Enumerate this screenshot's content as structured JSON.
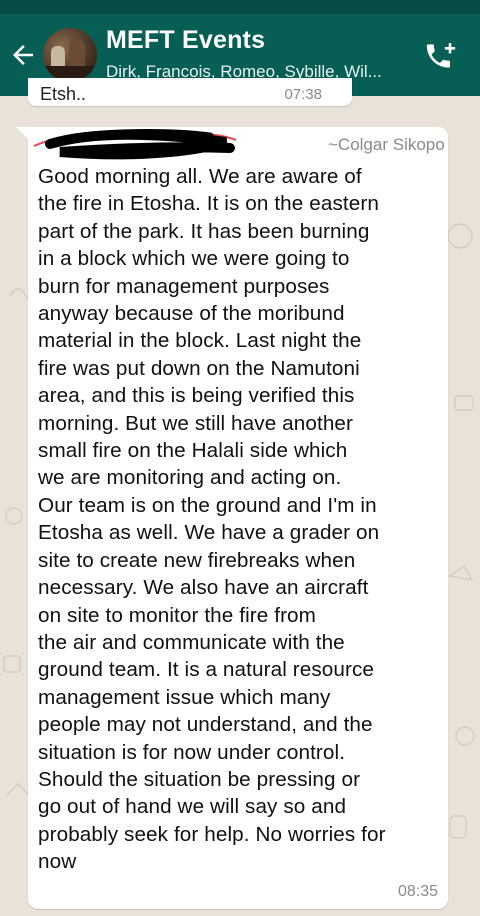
{
  "header": {
    "title": "MEFT Events",
    "subtitle": "Dirk, Francois, Romeo, Sybille, Wil..."
  },
  "previous_message": {
    "text": "Etsh..",
    "time": "07:38"
  },
  "message": {
    "sender": "~Colgar Sikopo",
    "time": "08:35",
    "text": "Good morning all. We are aware of\nthe fire in Etosha. It is on the eastern\npart of the park. It has been burning\nin a block which we were going to\nburn for management purposes\nanyway because of the moribund\nmaterial in the block. Last night the\nfire was put down on the Namutoni\narea, and this is being verified this\nmorning. But we still have another\nsmall fire on the Halali side which\nwe are monitoring and acting on.\nOur team is on the ground and I'm in\nEtosha as well. We have a grader on\nsite to create new firebreaks when\nnecessary. We also have an aircraft\non site to monitor the fire from\nthe air and communicate with the\nground team. It is a natural resource\nmanagement issue which many\npeople may not understand, and the\nsituation is for now under control.\nShould the situation be pressing or\ngo out of hand we will say so and\nprobably seek for help. No worries for\nnow"
  },
  "icons": {
    "back": "arrow-left-icon",
    "call": "add-call-icon",
    "redaction": "redaction-scribble"
  },
  "colors": {
    "header": "#075e54",
    "wallpaper": "#e9e2d8",
    "bubble": "#ffffff"
  }
}
